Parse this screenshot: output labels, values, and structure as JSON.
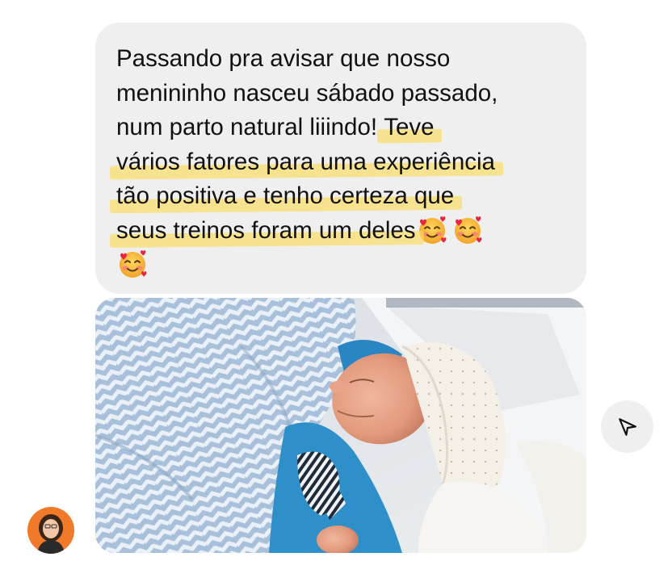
{
  "message": {
    "lines": [
      {
        "text": "Passando pra avisar que nosso"
      },
      {
        "text": "menininho nasceu sábado passado,"
      },
      {
        "text": "num parto natural liiindo! ",
        "highlight": "Teve"
      },
      {
        "highlight": "vários fatores para uma experiência"
      },
      {
        "highlight": "tão positiva e tenho certeza que"
      },
      {
        "highlight": "seus treinos foram um deles"
      }
    ],
    "emoji_icon": "smiling-face-with-hearts-emoji",
    "highlight_color": "#FADC5A"
  },
  "attachment": {
    "icon": "newborn-baby-photo"
  },
  "actions": {
    "share_icon": "paper-plane-icon"
  },
  "sender": {
    "avatar_icon": "user-avatar"
  }
}
